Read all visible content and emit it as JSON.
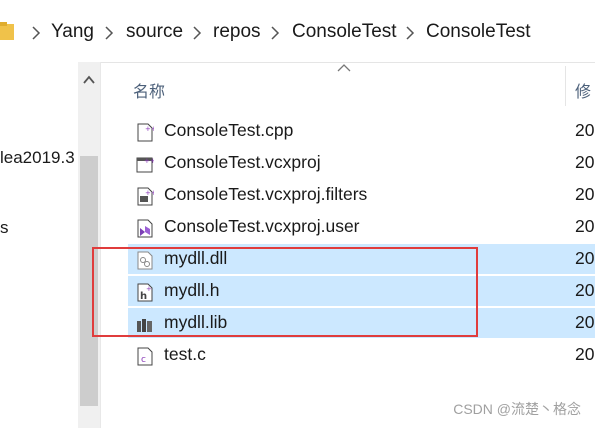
{
  "breadcrumb": [
    "Yang",
    "source",
    "repos",
    "ConsoleTest",
    "ConsoleTest"
  ],
  "nav": {
    "items": [
      "lea2019.3",
      "s"
    ]
  },
  "columns": {
    "name": "名称",
    "modified": "修"
  },
  "files": [
    {
      "name": "ConsoleTest.cpp",
      "modified": "20",
      "icon": "cpp-file-icon",
      "selected": false
    },
    {
      "name": "ConsoleTest.vcxproj",
      "modified": "20",
      "icon": "vcxproj-file-icon",
      "selected": false
    },
    {
      "name": "ConsoleTest.vcxproj.filters",
      "modified": "20",
      "icon": "filters-file-icon",
      "selected": false
    },
    {
      "name": "ConsoleTest.vcxproj.user",
      "modified": "20",
      "icon": "user-file-icon",
      "selected": false
    },
    {
      "name": "mydll.dll",
      "modified": "20",
      "icon": "dll-file-icon",
      "selected": true
    },
    {
      "name": "mydll.h",
      "modified": "20",
      "icon": "header-file-icon",
      "selected": true
    },
    {
      "name": "mydll.lib",
      "modified": "20",
      "icon": "lib-file-icon",
      "selected": true
    },
    {
      "name": "test.c",
      "modified": "20",
      "icon": "c-file-icon",
      "selected": false
    }
  ],
  "watermark": "CSDN @流楚丶格念",
  "colors": {
    "selection": "#cce8ff",
    "highlight_border": "#e03c3c",
    "folder": "#f0c24a"
  }
}
